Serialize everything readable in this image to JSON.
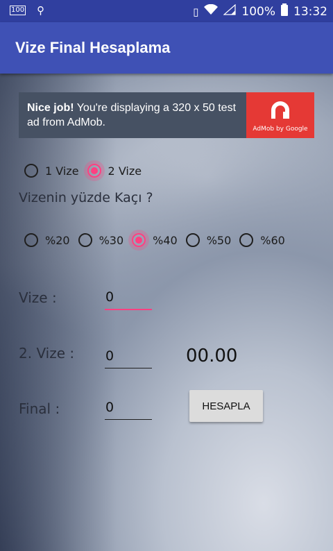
{
  "status_bar": {
    "left_icons": [
      "battery-100-icon",
      "usb-icon"
    ],
    "battery_level": "100",
    "battery_percent": "100%",
    "time": "13:32",
    "right_icons": [
      "vibrate-icon",
      "wifi-icon",
      "signal-icon",
      "battery-icon"
    ]
  },
  "app_bar": {
    "title": "Vize Final Hesaplama"
  },
  "ad": {
    "bold_text": "Nice job!",
    "text": " You're displaying a 320 x 50 test ad from AdMob.",
    "brand": "AdMob by Google"
  },
  "vize_count": {
    "options": [
      {
        "label": "1 Vize",
        "checked": false
      },
      {
        "label": "2 Vize",
        "checked": true
      }
    ]
  },
  "percent_question": "Vizenin yüzde Kaçı ?",
  "percent": {
    "options": [
      {
        "label": "%20",
        "checked": false
      },
      {
        "label": "%30",
        "checked": false
      },
      {
        "label": "%40",
        "checked": true
      },
      {
        "label": "%50",
        "checked": false
      },
      {
        "label": "%60",
        "checked": false
      }
    ]
  },
  "fields": {
    "vize": {
      "label": "Vize :",
      "value": "0"
    },
    "vize2": {
      "label": "2. Vize :",
      "value": "0"
    },
    "final": {
      "label": "Final :",
      "value": "0"
    }
  },
  "result": "00.00",
  "calculate_button": "HESAPLA",
  "colors": {
    "primary": "#3f51b5",
    "primary_dark": "#303f9f",
    "accent": "#ff4081",
    "ad_red": "#e53935"
  }
}
